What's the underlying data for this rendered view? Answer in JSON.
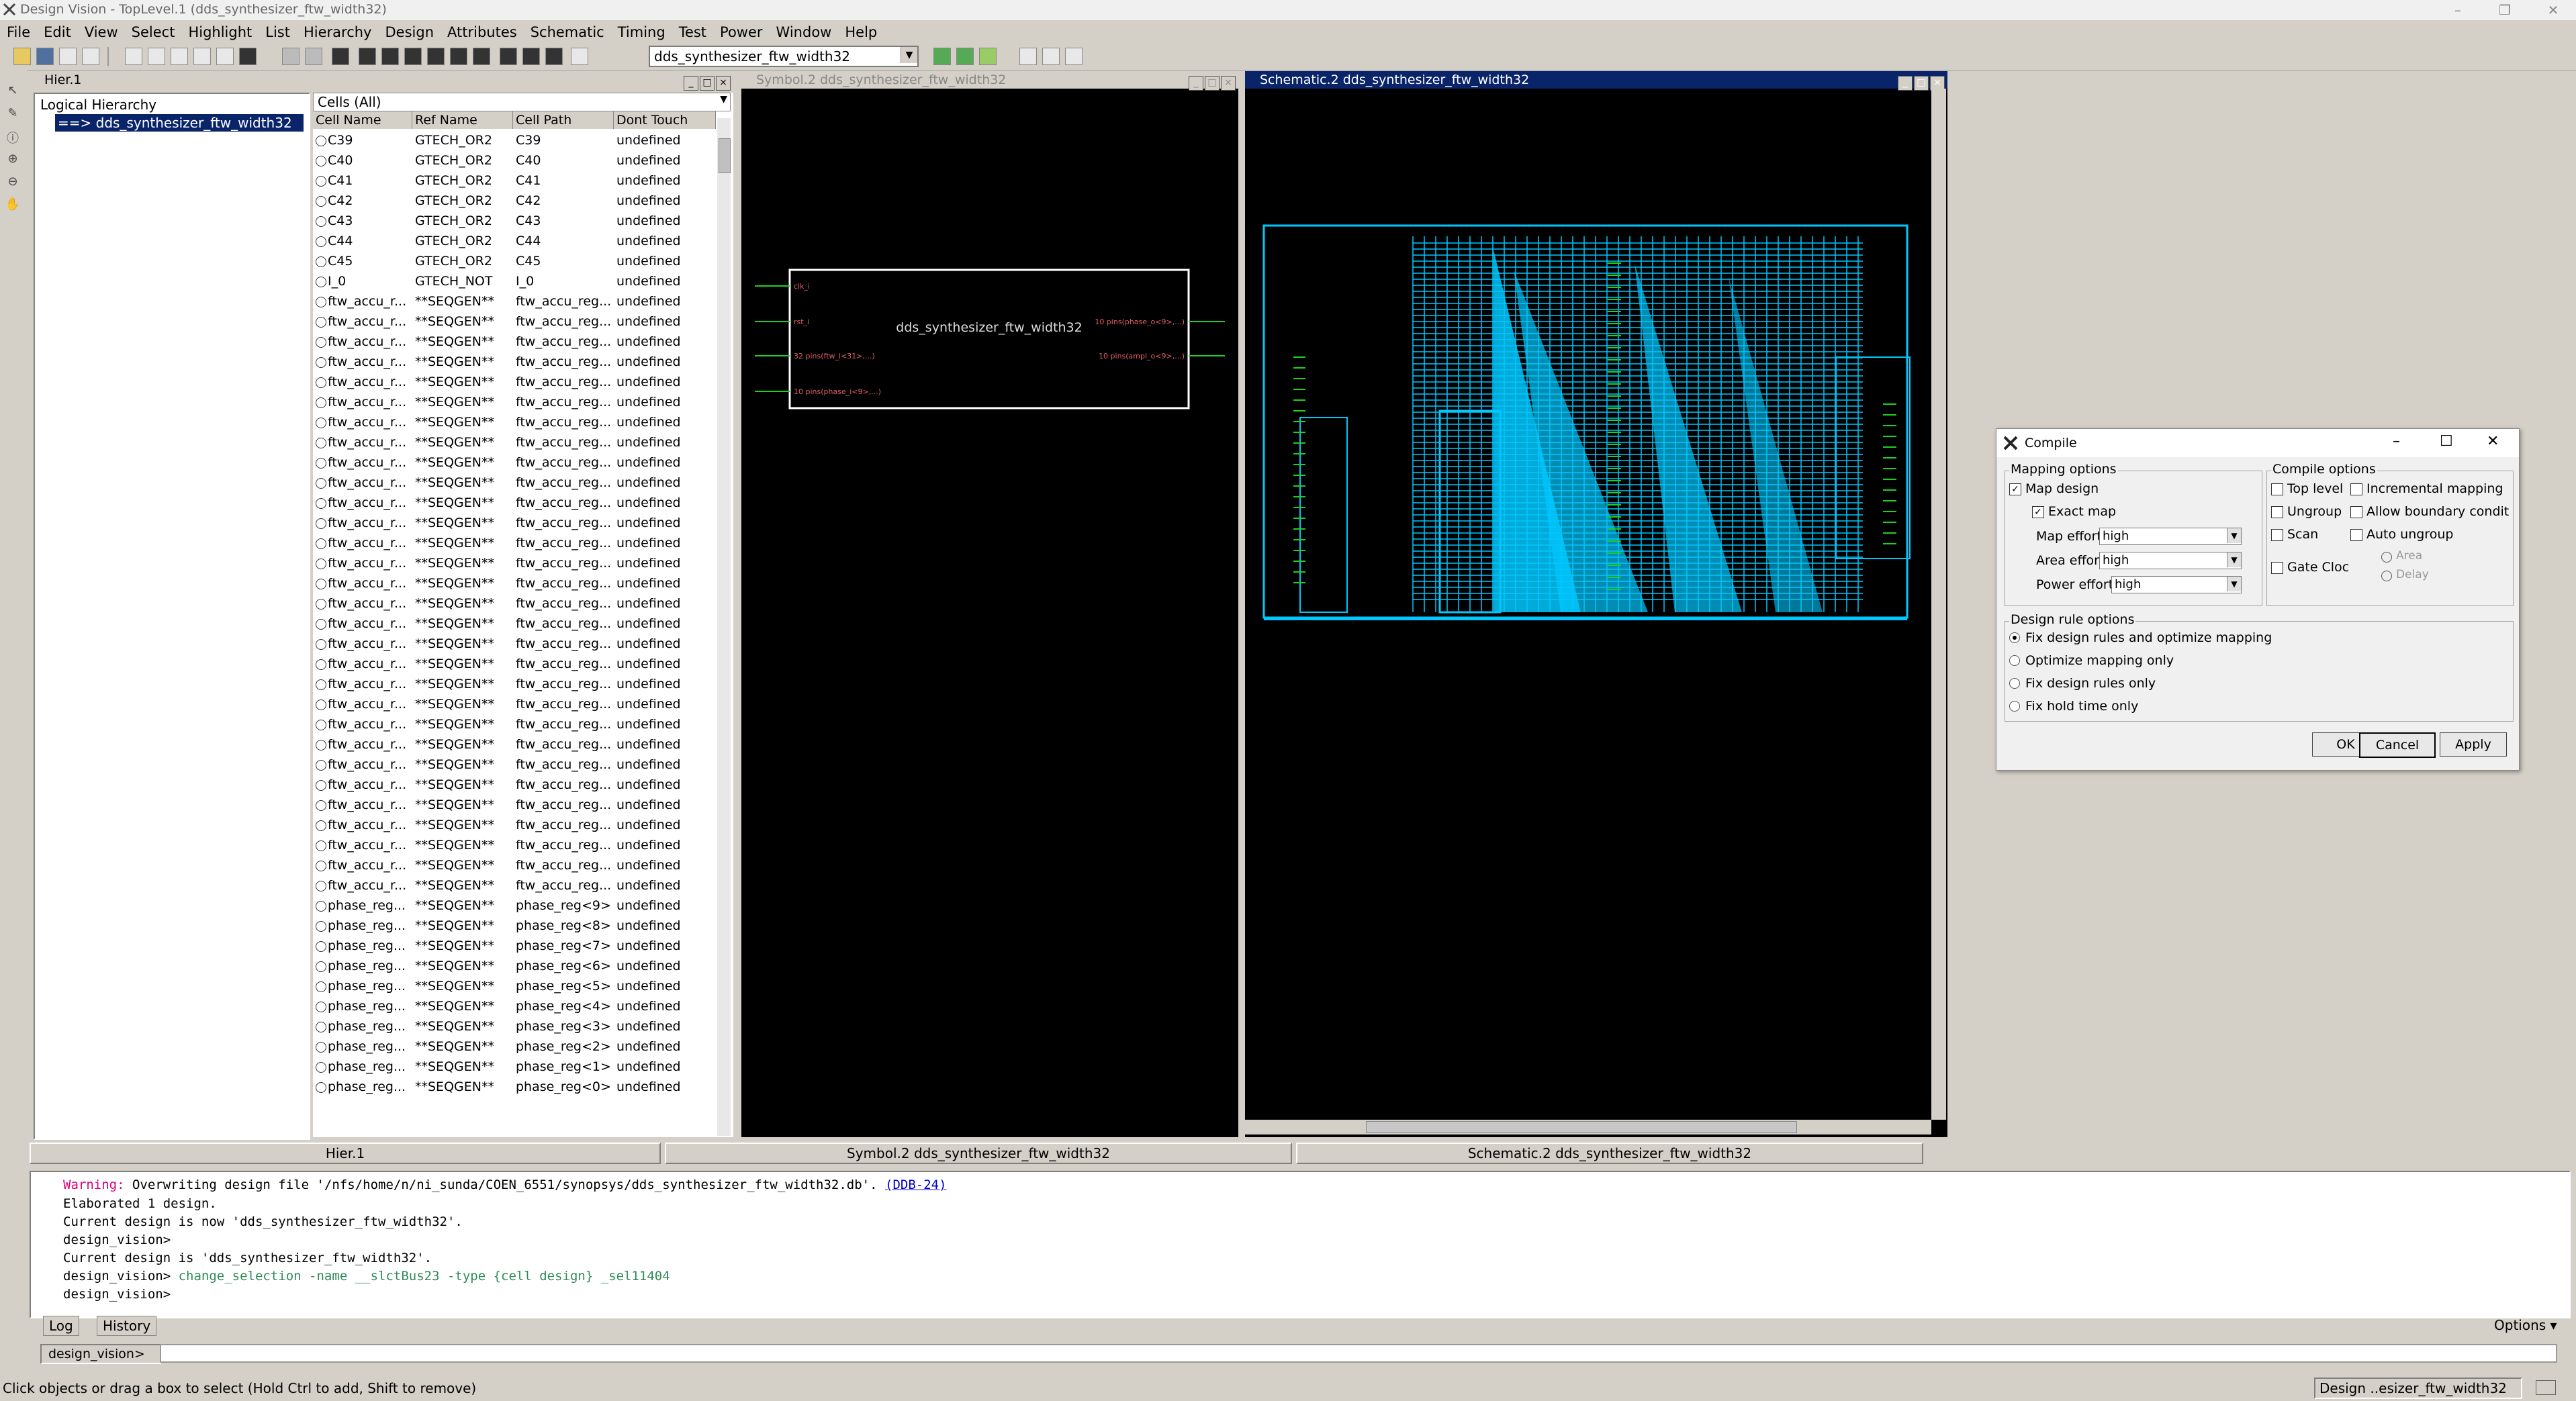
{
  "window": {
    "title": "Design Vision - TopLevel.1 (dds_synthesizer_ftw_width32)"
  },
  "menu": [
    "File",
    "Edit",
    "View",
    "Select",
    "Highlight",
    "List",
    "Hierarchy",
    "Design",
    "Attributes",
    "Schematic",
    "Timing",
    "Test",
    "Power",
    "Window",
    "Help"
  ],
  "toolbar": {
    "design_select": "dds_synthesizer_ftw_width32"
  },
  "hier_panel": {
    "title": "Hier.1",
    "tree_header": "Logical Hierarchy",
    "tree_selected": "==> dds_synthesizer_ftw_width32",
    "cells_filter": "Cells (All)",
    "columns": [
      "Cell Name",
      "Ref Name",
      "Cell Path",
      "Dont Touch"
    ],
    "rows": [
      [
        "C39",
        "GTECH_OR2",
        "C39",
        "undefined"
      ],
      [
        "C40",
        "GTECH_OR2",
        "C40",
        "undefined"
      ],
      [
        "C41",
        "GTECH_OR2",
        "C41",
        "undefined"
      ],
      [
        "C42",
        "GTECH_OR2",
        "C42",
        "undefined"
      ],
      [
        "C43",
        "GTECH_OR2",
        "C43",
        "undefined"
      ],
      [
        "C44",
        "GTECH_OR2",
        "C44",
        "undefined"
      ],
      [
        "C45",
        "GTECH_OR2",
        "C45",
        "undefined"
      ],
      [
        "I_0",
        "GTECH_NOT",
        "I_0",
        "undefined"
      ],
      [
        "ftw_accu_r...",
        "**SEQGEN**",
        "ftw_accu_reg...",
        "undefined"
      ],
      [
        "ftw_accu_r...",
        "**SEQGEN**",
        "ftw_accu_reg...",
        "undefined"
      ],
      [
        "ftw_accu_r...",
        "**SEQGEN**",
        "ftw_accu_reg...",
        "undefined"
      ],
      [
        "ftw_accu_r...",
        "**SEQGEN**",
        "ftw_accu_reg...",
        "undefined"
      ],
      [
        "ftw_accu_r...",
        "**SEQGEN**",
        "ftw_accu_reg...",
        "undefined"
      ],
      [
        "ftw_accu_r...",
        "**SEQGEN**",
        "ftw_accu_reg...",
        "undefined"
      ],
      [
        "ftw_accu_r...",
        "**SEQGEN**",
        "ftw_accu_reg...",
        "undefined"
      ],
      [
        "ftw_accu_r...",
        "**SEQGEN**",
        "ftw_accu_reg...",
        "undefined"
      ],
      [
        "ftw_accu_r...",
        "**SEQGEN**",
        "ftw_accu_reg...",
        "undefined"
      ],
      [
        "ftw_accu_r...",
        "**SEQGEN**",
        "ftw_accu_reg...",
        "undefined"
      ],
      [
        "ftw_accu_r...",
        "**SEQGEN**",
        "ftw_accu_reg...",
        "undefined"
      ],
      [
        "ftw_accu_r...",
        "**SEQGEN**",
        "ftw_accu_reg...",
        "undefined"
      ],
      [
        "ftw_accu_r...",
        "**SEQGEN**",
        "ftw_accu_reg...",
        "undefined"
      ],
      [
        "ftw_accu_r...",
        "**SEQGEN**",
        "ftw_accu_reg...",
        "undefined"
      ],
      [
        "ftw_accu_r...",
        "**SEQGEN**",
        "ftw_accu_reg...",
        "undefined"
      ],
      [
        "ftw_accu_r...",
        "**SEQGEN**",
        "ftw_accu_reg...",
        "undefined"
      ],
      [
        "ftw_accu_r...",
        "**SEQGEN**",
        "ftw_accu_reg...",
        "undefined"
      ],
      [
        "ftw_accu_r...",
        "**SEQGEN**",
        "ftw_accu_reg...",
        "undefined"
      ],
      [
        "ftw_accu_r...",
        "**SEQGEN**",
        "ftw_accu_reg...",
        "undefined"
      ],
      [
        "ftw_accu_r...",
        "**SEQGEN**",
        "ftw_accu_reg...",
        "undefined"
      ],
      [
        "ftw_accu_r...",
        "**SEQGEN**",
        "ftw_accu_reg...",
        "undefined"
      ],
      [
        "ftw_accu_r...",
        "**SEQGEN**",
        "ftw_accu_reg...",
        "undefined"
      ],
      [
        "ftw_accu_r...",
        "**SEQGEN**",
        "ftw_accu_reg...",
        "undefined"
      ],
      [
        "ftw_accu_r...",
        "**SEQGEN**",
        "ftw_accu_reg...",
        "undefined"
      ],
      [
        "ftw_accu_r...",
        "**SEQGEN**",
        "ftw_accu_reg...",
        "undefined"
      ],
      [
        "ftw_accu_r...",
        "**SEQGEN**",
        "ftw_accu_reg...",
        "undefined"
      ],
      [
        "ftw_accu_r...",
        "**SEQGEN**",
        "ftw_accu_reg...",
        "undefined"
      ],
      [
        "ftw_accu_r...",
        "**SEQGEN**",
        "ftw_accu_reg...",
        "undefined"
      ],
      [
        "ftw_accu_r...",
        "**SEQGEN**",
        "ftw_accu_reg...",
        "undefined"
      ],
      [
        "ftw_accu_r...",
        "**SEQGEN**",
        "ftw_accu_reg...",
        "undefined"
      ],
      [
        "phase_reg...",
        "**SEQGEN**",
        "phase_reg<9>",
        "undefined"
      ],
      [
        "phase_reg...",
        "**SEQGEN**",
        "phase_reg<8>",
        "undefined"
      ],
      [
        "phase_reg...",
        "**SEQGEN**",
        "phase_reg<7>",
        "undefined"
      ],
      [
        "phase_reg...",
        "**SEQGEN**",
        "phase_reg<6>",
        "undefined"
      ],
      [
        "phase_reg...",
        "**SEQGEN**",
        "phase_reg<5>",
        "undefined"
      ],
      [
        "phase_reg...",
        "**SEQGEN**",
        "phase_reg<4>",
        "undefined"
      ],
      [
        "phase_reg...",
        "**SEQGEN**",
        "phase_reg<3>",
        "undefined"
      ],
      [
        "phase_reg...",
        "**SEQGEN**",
        "phase_reg<2>",
        "undefined"
      ],
      [
        "phase_reg...",
        "**SEQGEN**",
        "phase_reg<1>",
        "undefined"
      ],
      [
        "phase_reg...",
        "**SEQGEN**",
        "phase_reg<0>",
        "undefined"
      ]
    ]
  },
  "symbol_panel": {
    "title": "Symbol.2   dds_synthesizer_ftw_width32",
    "block_name": "dds_synthesizer_ftw_width32",
    "pins_left": [
      "clk_i",
      "rst_i",
      "32 pins(ftw_i<31>,...)",
      "10 pins(phase_i<9>,...)"
    ],
    "pins_right": [
      "10 pins(phase_o<9>,...)",
      "10 pins(ampl_o<9>,...)"
    ]
  },
  "schematic_panel": {
    "title": "Schematic.2   dds_synthesizer_ftw_width32"
  },
  "tabs": [
    "Hier.1",
    "Symbol.2   dds_synthesizer_ftw_width32",
    "Schematic.2   dds_synthesizer_ftw_width32"
  ],
  "console": {
    "lines": [
      {
        "prefix": "Warning:",
        "text": " Overwriting design file '/nfs/home/n/ni_sunda/COEN_6551/synopsys/dds_synthesizer_ftw_width32.db'.",
        "link": "(DDB-24)"
      },
      {
        "text": "Elaborated 1 design."
      },
      {
        "text": "Current design is now 'dds_synthesizer_ftw_width32'."
      },
      {
        "text": "design_vision>"
      },
      {
        "text": "Current design is 'dds_synthesizer_ftw_width32'."
      },
      {
        "prefix": "design_vision>",
        "cmd": " change_selection -name __slctBus23 -type {cell design} _sel11404"
      },
      {
        "text": "design_vision>"
      }
    ],
    "tabs": [
      "Log",
      "History"
    ],
    "options": "Options",
    "prompt": "design_vision>",
    "cmd_value": ""
  },
  "status": {
    "message": "Click objects or drag a box to select (Hold Ctrl to add, Shift to remove)",
    "design_label": "Design",
    "design_value": "..esizer_ftw_width32"
  },
  "compile_dialog": {
    "title": "Compile",
    "mapping_group": "Mapping options",
    "map_design": "Map design",
    "exact_map": "Exact map",
    "map_effort_label": "Map effort:",
    "map_effort": "high",
    "area_effort_label": "Area effort:",
    "area_effort": "high",
    "power_effort_label": "Power effort:",
    "power_effort": "high",
    "compile_group": "Compile options",
    "top_level": "Top level",
    "incremental": "Incremental mapping",
    "ungroup": "Ungroup",
    "allow_boundary": "Allow boundary condition",
    "scan": "Scan",
    "auto_ungroup": "Auto ungroup",
    "area": "Area",
    "delay": "Delay",
    "gate_clock": "Gate Cloc",
    "drc_group": "Design rule options",
    "drc_options": [
      "Fix design rules and  optimize mapping",
      "Optimize mapping only",
      "Fix design rules only",
      "Fix hold time only"
    ],
    "ok": "OK",
    "cancel": "Cancel",
    "apply": "Apply"
  },
  "colors": {
    "accent": "#0a246a",
    "schematic_wire": "#00c8ff",
    "schematic_green": "#20d020",
    "warning": "#e0007a",
    "command": "#2e8b57"
  }
}
